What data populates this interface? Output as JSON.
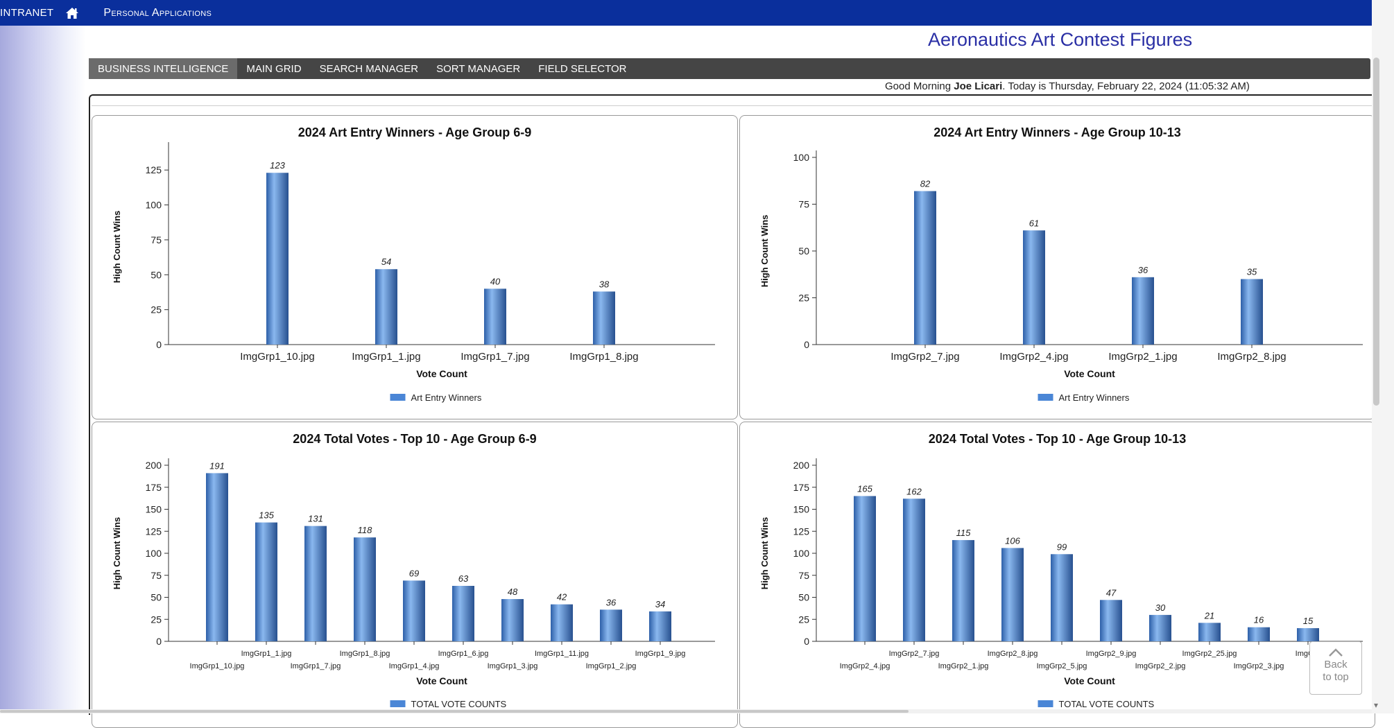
{
  "topbar": {
    "intranet": "INTRANET",
    "personal_apps": "Personal Applications",
    "home_icon": "home-icon"
  },
  "page_title": "Aeronautics Art Contest Figures",
  "nav": {
    "tabs": [
      {
        "label": "BUSINESS INTELLIGENCE",
        "active": true
      },
      {
        "label": "MAIN GRID",
        "active": false
      },
      {
        "label": "SEARCH MANAGER",
        "active": false
      },
      {
        "label": "SORT MANAGER",
        "active": false
      },
      {
        "label": "FIELD SELECTOR",
        "active": false
      }
    ]
  },
  "greeting": {
    "prefix": "Good Morning ",
    "user": "Joe Licari",
    "suffix": ". Today is Thursday, February 22, 2024 (11:05:32 AM)"
  },
  "back_to_top": {
    "line1": "Back",
    "line2": "to top"
  },
  "colors": {
    "topbar": "#0a2f9c",
    "bar": "#4a86d6",
    "title": "#2a2fa5",
    "nav": "#454545"
  },
  "chart_data": [
    {
      "type": "bar",
      "title": "2024 Art Entry Winners - Age Group 6-9",
      "xlabel": "Vote Count",
      "ylabel": "High Count Wins",
      "categories": [
        "ImgGrp1_10.jpg",
        "ImgGrp1_1.jpg",
        "ImgGrp1_7.jpg",
        "ImgGrp1_8.jpg"
      ],
      "series": [
        {
          "name": "Art Entry Winners",
          "values": [
            123,
            54,
            40,
            38
          ]
        }
      ],
      "ylim": [
        0,
        140
      ],
      "yticks": [
        0,
        25,
        50,
        75,
        100,
        125
      ],
      "legend": "bottom",
      "grid": false
    },
    {
      "type": "bar",
      "title": "2024 Art Entry Winners - Age Group 10-13",
      "xlabel": "Vote Count",
      "ylabel": "High Count Wins",
      "categories": [
        "ImgGrp2_7.jpg",
        "ImgGrp2_4.jpg",
        "ImgGrp2_1.jpg",
        "ImgGrp2_8.jpg"
      ],
      "series": [
        {
          "name": "Art Entry Winners",
          "values": [
            82,
            61,
            36,
            35
          ]
        }
      ],
      "ylim": [
        0,
        100
      ],
      "yticks": [
        0,
        25,
        50,
        75,
        100
      ],
      "legend": "bottom",
      "grid": false
    },
    {
      "type": "bar",
      "title": "2024 Total Votes - Top 10 - Age Group 6-9",
      "xlabel": "Vote Count",
      "ylabel": "High Count Wins",
      "categories": [
        "ImgGrp1_10.jpg",
        "ImgGrp1_1.jpg",
        "ImgGrp1_7.jpg",
        "ImgGrp1_8.jpg",
        "ImgGrp1_4.jpg",
        "ImgGrp1_6.jpg",
        "ImgGrp1_3.jpg",
        "ImgGrp1_11.jpg",
        "ImgGrp1_2.jpg",
        "ImgGrp1_9.jpg"
      ],
      "series": [
        {
          "name": "TOTAL VOTE COUNTS",
          "values": [
            191,
            135,
            131,
            118,
            69,
            63,
            48,
            42,
            36,
            34
          ]
        }
      ],
      "ylim": [
        0,
        200
      ],
      "yticks": [
        0,
        25,
        50,
        75,
        100,
        125,
        150,
        175,
        200
      ],
      "legend": "bottom",
      "grid": false
    },
    {
      "type": "bar",
      "title": "2024 Total Votes - Top 10 - Age Group 10-13",
      "xlabel": "Vote Count",
      "ylabel": "High Count Wins",
      "categories": [
        "ImgGrp2_4.jpg",
        "ImgGrp2_7.jpg",
        "ImgGrp2_1.jpg",
        "ImgGrp2_8.jpg",
        "ImgGrp2_5.jpg",
        "ImgGrp2_9.jpg",
        "ImgGrp2_2.jpg",
        "ImgGrp2_25.jpg",
        "ImgGrp2_3.jpg",
        "ImgGrp"
      ],
      "series": [
        {
          "name": "TOTAL VOTE COUNTS",
          "values": [
            165,
            162,
            115,
            106,
            99,
            47,
            30,
            21,
            16,
            15
          ]
        }
      ],
      "ylim": [
        0,
        200
      ],
      "yticks": [
        0,
        25,
        50,
        75,
        100,
        125,
        150,
        175,
        200
      ],
      "legend": "bottom",
      "grid": false
    }
  ]
}
